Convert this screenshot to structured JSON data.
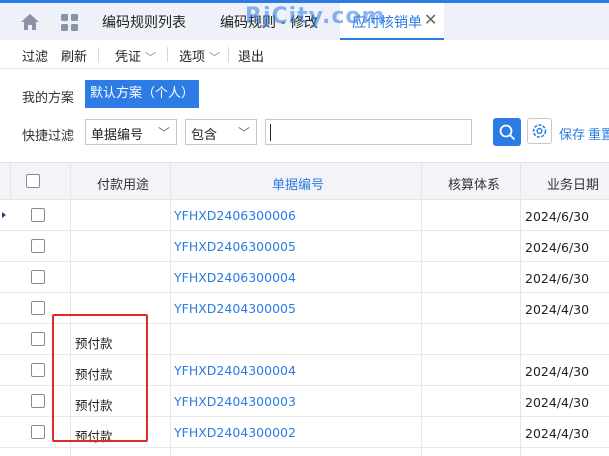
{
  "tabs": {
    "items": [
      {
        "label": "编码规则列表"
      },
      {
        "label": "编码规则 - 修改"
      },
      {
        "label": "应付核销单"
      }
    ]
  },
  "watermark": "RjCity.com",
  "toolbar": {
    "filter": "过滤",
    "refresh": "刷新",
    "voucher": "凭证",
    "options": "选项",
    "exit": "退出"
  },
  "filter": {
    "my_scheme_label": "我的方案",
    "default_scheme": "默认方案（个人）",
    "quick_filter_label": "快捷过滤",
    "field_select": "单据编号",
    "operator_select": "包含",
    "value_input": "",
    "save_link": "保存",
    "reset_link": "重置"
  },
  "table": {
    "columns": [
      "付款用途",
      "单据编号",
      "核算体系",
      "业务日期"
    ],
    "rows": [
      {
        "use": "",
        "code": "YFHXD2406300006",
        "system": "",
        "date": "2024/6/30"
      },
      {
        "use": "",
        "code": "YFHXD2406300005",
        "system": "",
        "date": "2024/6/30"
      },
      {
        "use": "",
        "code": "YFHXD2406300004",
        "system": "",
        "date": "2024/6/30"
      },
      {
        "use": "",
        "code": "YFHXD2404300005",
        "system": "",
        "date": "2024/4/30"
      },
      {
        "use": "预付款",
        "code": "",
        "system": "",
        "date": ""
      },
      {
        "use": "预付款",
        "code": "YFHXD2404300004",
        "system": "",
        "date": "2024/4/30"
      },
      {
        "use": "预付款",
        "code": "YFHXD2404300003",
        "system": "",
        "date": "2024/4/30"
      },
      {
        "use": "预付款",
        "code": "YFHXD2404300002",
        "system": "",
        "date": "2024/4/30"
      }
    ]
  },
  "colors": {
    "accent": "#2d7be5",
    "highlight": "#e02a2a"
  }
}
